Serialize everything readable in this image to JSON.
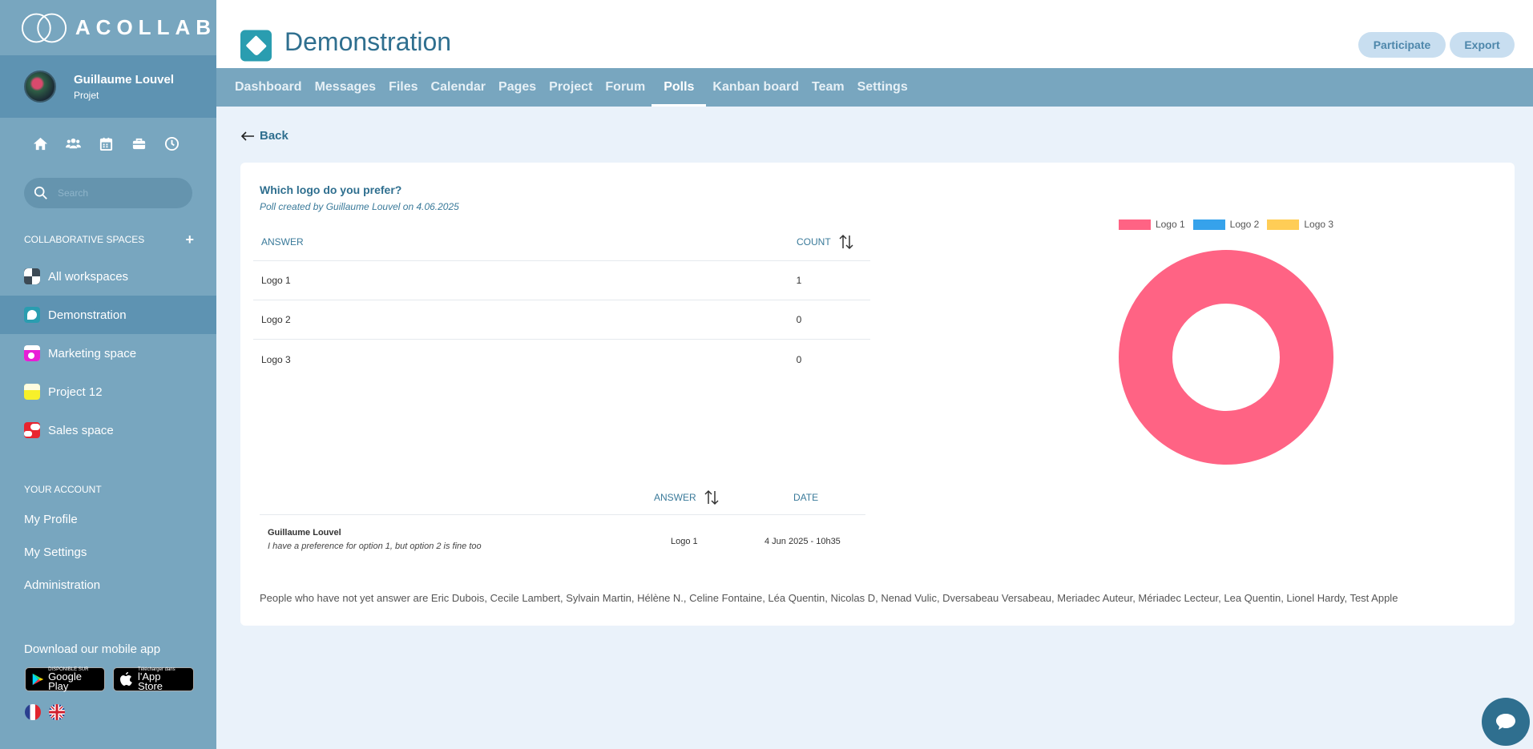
{
  "app": {
    "brand": "ACOLLAB"
  },
  "user": {
    "name": "Guillaume Louvel",
    "role": "Projet"
  },
  "search": {
    "placeholder": "Search"
  },
  "sidebar": {
    "collab_title": "COLLABORATIVE SPACES",
    "workspaces": [
      {
        "label": "All workspaces",
        "color": "#ffffff"
      },
      {
        "label": "Demonstration",
        "color": "#2a9db0"
      },
      {
        "label": "Marketing space",
        "color": "#e81ed6"
      },
      {
        "label": "Project 12",
        "color": "#f7f02a"
      },
      {
        "label": "Sales space",
        "color": "#e82530"
      }
    ],
    "account_title": "YOUR ACCOUNT",
    "account_items": [
      {
        "label": "My Profile"
      },
      {
        "label": "My Settings"
      },
      {
        "label": "Administration"
      }
    ],
    "download_label": "Download our mobile app",
    "google_play": {
      "small": "DISPONIBLE SUR",
      "big": "Google Play"
    },
    "app_store": {
      "small": "Télécharger dans",
      "big": "l'App Store"
    }
  },
  "header": {
    "title": "Demonstration",
    "participate_label": "Participate",
    "export_label": "Export"
  },
  "tabs": [
    {
      "label": "Dashboard"
    },
    {
      "label": "Messages"
    },
    {
      "label": "Files"
    },
    {
      "label": "Calendar"
    },
    {
      "label": "Pages"
    },
    {
      "label": "Project"
    },
    {
      "label": "Forum"
    },
    {
      "label": "Polls",
      "active": true
    },
    {
      "label": "Kanban board"
    },
    {
      "label": "Team"
    },
    {
      "label": "Settings"
    }
  ],
  "back_label": "Back",
  "poll": {
    "question": "Which logo do you prefer?",
    "meta": "Poll created by Guillaume Louvel on 4.06.2025",
    "answer_header": "ANSWER",
    "count_header": "COUNT",
    "answers": [
      {
        "label": "Logo 1",
        "count": "1"
      },
      {
        "label": "Logo 2",
        "count": "0"
      },
      {
        "label": "Logo 3",
        "count": "0"
      }
    ],
    "responses_header": {
      "answer": "ANSWER",
      "date": "DATE"
    },
    "responses": [
      {
        "name": "Guillaume Louvel",
        "comment": "I have a preference for option 1, but option 2 is fine too",
        "answer": "Logo 1",
        "date": "4 Jun 2025 - 10h35"
      }
    ],
    "not_answered": "People who have not yet answer are Eric Dubois, Cecile Lambert, Sylvain Martin, Hélène N., Celine Fontaine, Léa Quentin, Nicolas D, Nenad Vulic, Dversabeau Versabeau, Meriadec Auteur, Mériadec Lecteur, Lea Quentin, Lionel Hardy, Test Apple"
  },
  "chart_data": {
    "type": "pie",
    "donut": true,
    "categories": [
      "Logo 1",
      "Logo 2",
      "Logo 3"
    ],
    "values": [
      1,
      0,
      0
    ],
    "colors": [
      "#ff6384",
      "#36a2eb",
      "#ffcd56"
    ],
    "legend": "top"
  }
}
